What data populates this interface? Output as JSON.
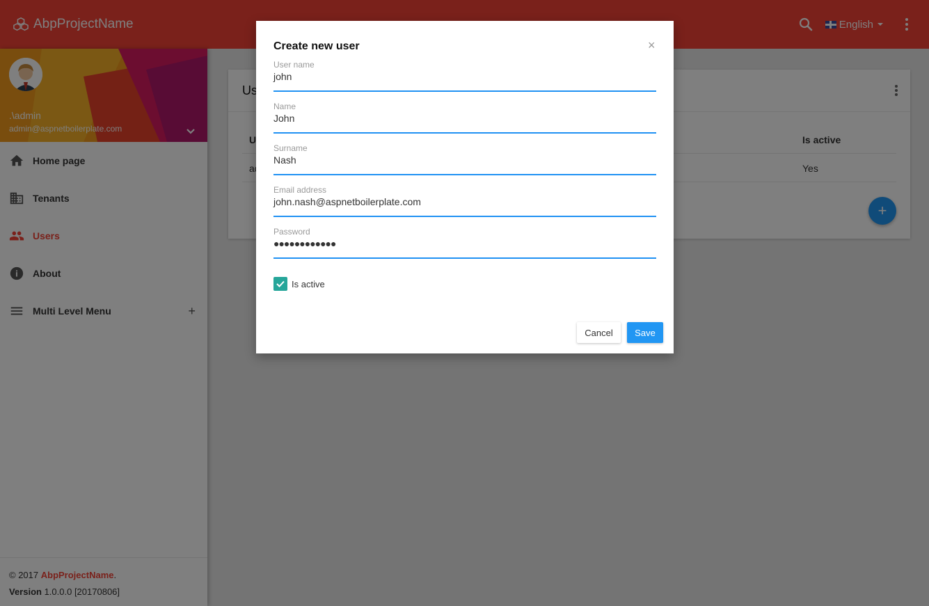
{
  "app": {
    "brand": "AbpProjectName",
    "language": "English"
  },
  "user": {
    "name": ".\\admin",
    "email": "admin@aspnetboilerplate.com"
  },
  "menu": {
    "items": [
      {
        "label": "Home page",
        "icon": "home-icon"
      },
      {
        "label": "Tenants",
        "icon": "building-icon"
      },
      {
        "label": "Users",
        "icon": "people-icon",
        "active": true
      },
      {
        "label": "About",
        "icon": "info-icon"
      },
      {
        "label": "Multi Level Menu",
        "icon": "menu-icon",
        "expand": "+"
      }
    ]
  },
  "footer": {
    "copyright": "© 2017 ",
    "brand": "AbpProjectName",
    "dot": ".",
    "version_label": "Version",
    "version_value": " 1.0.0.0 [20170806]"
  },
  "card": {
    "title": "Us",
    "columns": [
      "U",
      "Is active"
    ],
    "row": [
      "ad",
      "Yes"
    ],
    "fab": "+"
  },
  "modal": {
    "title": "Create new user",
    "close": "×",
    "fields": [
      {
        "label": "User name",
        "value": "john"
      },
      {
        "label": "Name",
        "value": "John"
      },
      {
        "label": "Surname",
        "value": "Nash"
      },
      {
        "label": "Email address",
        "value": "john.nash@aspnetboilerplate.com"
      },
      {
        "label": "Password",
        "value": "●●●●●●●●●●●●"
      }
    ],
    "is_active_label": "Is active",
    "is_active_checked": true,
    "cancel": "Cancel",
    "save": "Save"
  },
  "colors": {
    "primary": "#f44336",
    "accent": "#2196f3",
    "checkbox": "#26a69a"
  }
}
